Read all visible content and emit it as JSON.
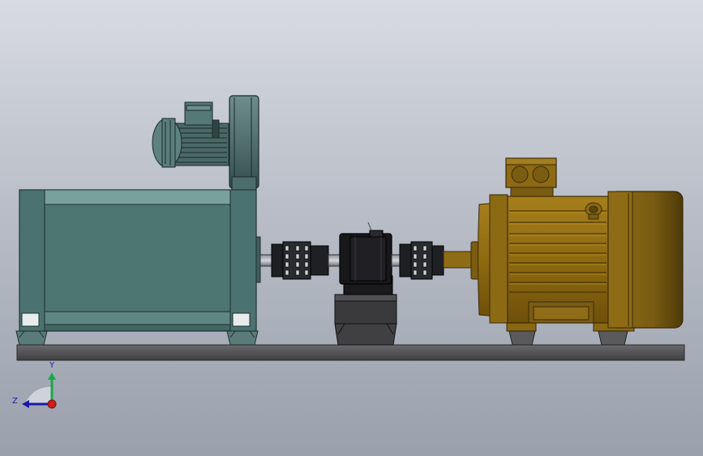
{
  "viewport": {
    "background_top": "#d8dbe2",
    "background_bottom": "#9aa0ac"
  },
  "model": {
    "dc_motor_color": "#4f7b77",
    "blower_color": "#4a6a68",
    "ac_motor_color": "#9a7414",
    "torque_sensor_color": "#1c1c1e",
    "base_plate_color": "#505052"
  },
  "triad": {
    "y_label": "Y",
    "z_label": "Z",
    "y_color": "#1aa84b",
    "z_color": "#1a1aa8",
    "x_color": "#cc1e1e"
  }
}
